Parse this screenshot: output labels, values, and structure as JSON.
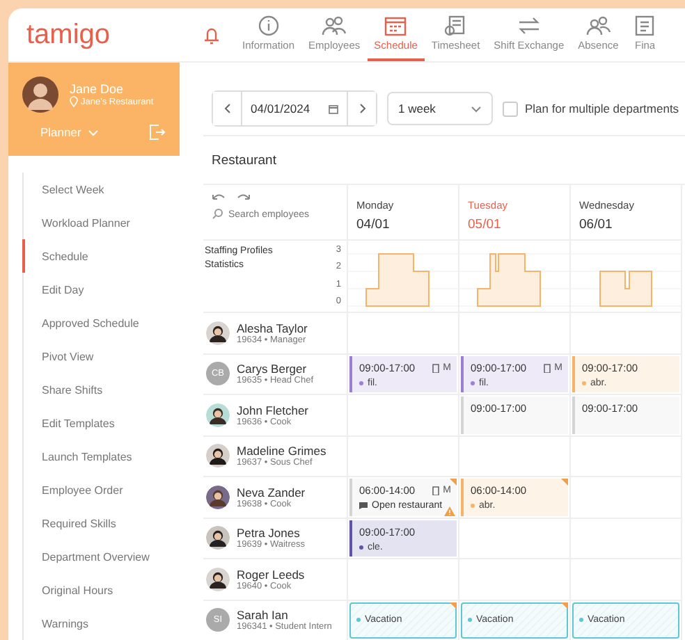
{
  "logo": "tamigo",
  "nav": [
    {
      "kind": "bell",
      "selected": false
    },
    {
      "kind": "info",
      "label": "Information",
      "selected": false
    },
    {
      "kind": "employees",
      "label": "Employees",
      "selected": false
    },
    {
      "kind": "schedule",
      "label": "Schedule",
      "selected": true
    },
    {
      "kind": "timesheet",
      "label": "Timesheet",
      "selected": false
    },
    {
      "kind": "exchange",
      "label": "Shift Exchange",
      "selected": false
    },
    {
      "kind": "absence",
      "label": "Absence",
      "selected": false
    },
    {
      "kind": "finance",
      "label": "Fina",
      "selected": false
    }
  ],
  "user": {
    "name": "Jane Doe",
    "location": "Jane's Restaurant",
    "role": "Planner"
  },
  "sidebar": {
    "items": [
      {
        "label": "Select Week",
        "selected": false
      },
      {
        "label": "Workload Planner",
        "selected": false
      },
      {
        "label": "Schedule",
        "selected": true
      },
      {
        "label": "Edit Day",
        "selected": false
      },
      {
        "label": "Approved Schedule",
        "selected": false
      },
      {
        "label": "Pivot View",
        "selected": false
      },
      {
        "label": "Share Shifts",
        "selected": false
      },
      {
        "label": "Edit Templates",
        "selected": false
      },
      {
        "label": "Launch Templates",
        "selected": false
      },
      {
        "label": "Employee Order",
        "selected": false
      },
      {
        "label": "Required Skills",
        "selected": false
      },
      {
        "label": "Department Overview",
        "selected": false
      },
      {
        "label": "Original Hours",
        "selected": false
      },
      {
        "label": "Warnings",
        "selected": false
      }
    ]
  },
  "toolbar": {
    "date": "04/01/2024",
    "period": "1 week",
    "multi_department": {
      "label": "Plan for multiple departments",
      "checked": false
    }
  },
  "department": "Restaurant",
  "search": {
    "placeholder": "Search employees"
  },
  "days": [
    {
      "weekday": "Monday",
      "date": "04/01",
      "today": false
    },
    {
      "weekday": "Tuesday",
      "date": "05/01",
      "today": true
    },
    {
      "weekday": "Wednesday",
      "date": "06/01",
      "today": false
    }
  ],
  "stats": {
    "label": "Staffing Profiles Statistics",
    "axis": [
      "3",
      "2",
      "1",
      "0"
    ]
  },
  "employees": [
    {
      "name": "Alesha Taylor",
      "info": "19634 • Manager",
      "avatar": {
        "kind": "photo"
      },
      "cells": [
        null,
        null,
        null
      ]
    },
    {
      "name": "Carys Berger",
      "info": "19635 • Head Chef",
      "avatar": {
        "kind": "initials",
        "text": "CB"
      },
      "cells": [
        {
          "kind": "shift",
          "time": "09:00-17:00",
          "tag": "fil.",
          "color": "#9b7fd4",
          "marker": "M",
          "flagged": false,
          "warning": false
        },
        {
          "kind": "shift",
          "time": "09:00-17:00",
          "tag": "fil.",
          "color": "#9b7fd4",
          "marker": "M",
          "flagged": false,
          "warning": false
        },
        {
          "kind": "shift",
          "time": "09:00-17:00",
          "tag": "abr.",
          "color": "#f5b46a",
          "flagged": false,
          "warning": false
        }
      ]
    },
    {
      "name": "John Fletcher",
      "info": "19636 • Cook",
      "avatar": {
        "kind": "photo"
      },
      "cells": [
        null,
        {
          "kind": "shift",
          "time": "09:00-17:00",
          "color": "#d4d4d4",
          "flagged": false,
          "warning": false
        },
        {
          "kind": "shift",
          "time": "09:00-17:00",
          "color": "#d4d4d4",
          "flagged": false,
          "warning": false
        }
      ]
    },
    {
      "name": "Madeline Grimes",
      "info": "19637 • Sous Chef",
      "avatar": {
        "kind": "photo"
      },
      "cells": [
        null,
        null,
        null
      ]
    },
    {
      "name": "Neva Zander",
      "info": "19638 • Cook",
      "avatar": {
        "kind": "photo"
      },
      "cells": [
        {
          "kind": "shift",
          "time": "06:00-14:00",
          "note": "Open restaurant",
          "color": "#d4d4d4",
          "marker": "M",
          "flagged": true,
          "warning": true
        },
        {
          "kind": "shift",
          "time": "06:00-14:00",
          "tag": "abr.",
          "color": "#f5b46a",
          "flagged": true,
          "warning": false
        },
        null
      ]
    },
    {
      "name": "Petra Jones",
      "info": "19639 • Waitress",
      "avatar": {
        "kind": "photo"
      },
      "cells": [
        {
          "kind": "shift",
          "time": "09:00-17:00",
          "tag": "cle.",
          "color": "#5e54a8",
          "flagged": false,
          "warning": false
        },
        null,
        null
      ]
    },
    {
      "name": "Roger Leeds",
      "info": "19640 • Cook",
      "avatar": {
        "kind": "photo"
      },
      "cells": [
        null,
        null,
        null
      ]
    },
    {
      "name": "Sarah Ian",
      "info": "196341 • Student Intern",
      "avatar": {
        "kind": "initials",
        "text": "SI"
      },
      "cells": [
        {
          "kind": "absence",
          "label": "Vacation",
          "color": "#5cc8d4",
          "flagged": true
        },
        {
          "kind": "absence",
          "label": "Vacation",
          "color": "#5cc8d4",
          "flagged": true
        },
        {
          "kind": "absence",
          "label": "Vacation",
          "color": "#5cc8d4",
          "flagged": false
        }
      ]
    }
  ]
}
